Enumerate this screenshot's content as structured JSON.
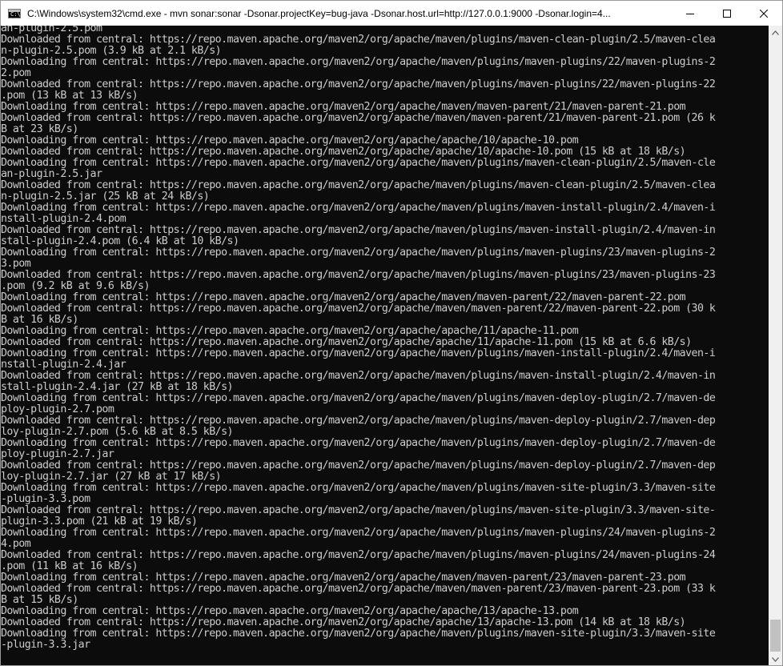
{
  "window": {
    "title": "C:\\Windows\\system32\\cmd.exe - mvn  sonar:sonar -Dsonar.projectKey=bug-java  -Dsonar.host.url=http://127.0.0.1:9000 -Dsonar.login=4...",
    "icon": "console-app-icon",
    "controls": [
      "minimize-icon",
      "maximize-icon",
      "close-icon"
    ]
  },
  "console": {
    "lines": [
      "an-plugin-2.5.pom",
      "Downloaded from central: https://repo.maven.apache.org/maven2/org/apache/maven/plugins/maven-clean-plugin/2.5/maven-clea",
      "n-plugin-2.5.pom (3.9 kB at 2.1 kB/s)",
      "Downloading from central: https://repo.maven.apache.org/maven2/org/apache/maven/plugins/maven-plugins/22/maven-plugins-2",
      "2.pom",
      "Downloaded from central: https://repo.maven.apache.org/maven2/org/apache/maven/plugins/maven-plugins/22/maven-plugins-22",
      ".pom (13 kB at 13 kB/s)",
      "Downloading from central: https://repo.maven.apache.org/maven2/org/apache/maven/maven-parent/21/maven-parent-21.pom",
      "Downloaded from central: https://repo.maven.apache.org/maven2/org/apache/maven/maven-parent/21/maven-parent-21.pom (26 k",
      "B at 23 kB/s)",
      "Downloading from central: https://repo.maven.apache.org/maven2/org/apache/apache/10/apache-10.pom",
      "Downloaded from central: https://repo.maven.apache.org/maven2/org/apache/apache/10/apache-10.pom (15 kB at 18 kB/s)",
      "Downloading from central: https://repo.maven.apache.org/maven2/org/apache/maven/plugins/maven-clean-plugin/2.5/maven-cle",
      "an-plugin-2.5.jar",
      "Downloaded from central: https://repo.maven.apache.org/maven2/org/apache/maven/plugins/maven-clean-plugin/2.5/maven-clea",
      "n-plugin-2.5.jar (25 kB at 24 kB/s)",
      "Downloading from central: https://repo.maven.apache.org/maven2/org/apache/maven/plugins/maven-install-plugin/2.4/maven-i",
      "nstall-plugin-2.4.pom",
      "Downloaded from central: https://repo.maven.apache.org/maven2/org/apache/maven/plugins/maven-install-plugin/2.4/maven-in",
      "stall-plugin-2.4.pom (6.4 kB at 10 kB/s)",
      "Downloading from central: https://repo.maven.apache.org/maven2/org/apache/maven/plugins/maven-plugins/23/maven-plugins-2",
      "3.pom",
      "Downloaded from central: https://repo.maven.apache.org/maven2/org/apache/maven/plugins/maven-plugins/23/maven-plugins-23",
      ".pom (9.2 kB at 9.6 kB/s)",
      "Downloading from central: https://repo.maven.apache.org/maven2/org/apache/maven/maven-parent/22/maven-parent-22.pom",
      "Downloaded from central: https://repo.maven.apache.org/maven2/org/apache/maven/maven-parent/22/maven-parent-22.pom (30 k",
      "B at 16 kB/s)",
      "Downloading from central: https://repo.maven.apache.org/maven2/org/apache/apache/11/apache-11.pom",
      "Downloaded from central: https://repo.maven.apache.org/maven2/org/apache/apache/11/apache-11.pom (15 kB at 6.6 kB/s)",
      "Downloading from central: https://repo.maven.apache.org/maven2/org/apache/maven/plugins/maven-install-plugin/2.4/maven-i",
      "nstall-plugin-2.4.jar",
      "Downloaded from central: https://repo.maven.apache.org/maven2/org/apache/maven/plugins/maven-install-plugin/2.4/maven-in",
      "stall-plugin-2.4.jar (27 kB at 18 kB/s)",
      "Downloading from central: https://repo.maven.apache.org/maven2/org/apache/maven/plugins/maven-deploy-plugin/2.7/maven-de",
      "ploy-plugin-2.7.pom",
      "Downloaded from central: https://repo.maven.apache.org/maven2/org/apache/maven/plugins/maven-deploy-plugin/2.7/maven-dep",
      "loy-plugin-2.7.pom (5.6 kB at 8.5 kB/s)",
      "Downloading from central: https://repo.maven.apache.org/maven2/org/apache/maven/plugins/maven-deploy-plugin/2.7/maven-de",
      "ploy-plugin-2.7.jar",
      "Downloaded from central: https://repo.maven.apache.org/maven2/org/apache/maven/plugins/maven-deploy-plugin/2.7/maven-dep",
      "loy-plugin-2.7.jar (27 kB at 17 kB/s)",
      "Downloading from central: https://repo.maven.apache.org/maven2/org/apache/maven/plugins/maven-site-plugin/3.3/maven-site",
      "-plugin-3.3.pom",
      "Downloaded from central: https://repo.maven.apache.org/maven2/org/apache/maven/plugins/maven-site-plugin/3.3/maven-site-",
      "plugin-3.3.pom (21 kB at 19 kB/s)",
      "Downloading from central: https://repo.maven.apache.org/maven2/org/apache/maven/plugins/maven-plugins/24/maven-plugins-2",
      "4.pom",
      "Downloaded from central: https://repo.maven.apache.org/maven2/org/apache/maven/plugins/maven-plugins/24/maven-plugins-24",
      ".pom (11 kB at 16 kB/s)",
      "Downloading from central: https://repo.maven.apache.org/maven2/org/apache/maven/maven-parent/23/maven-parent-23.pom",
      "Downloaded from central: https://repo.maven.apache.org/maven2/org/apache/maven/maven-parent/23/maven-parent-23.pom (33 k",
      "B at 15 kB/s)",
      "Downloading from central: https://repo.maven.apache.org/maven2/org/apache/apache/13/apache-13.pom",
      "Downloaded from central: https://repo.maven.apache.org/maven2/org/apache/apache/13/apache-13.pom (14 kB at 18 kB/s)",
      "Downloading from central: https://repo.maven.apache.org/maven2/org/apache/maven/plugins/maven-site-plugin/3.3/maven-site",
      "-plugin-3.3.jar"
    ]
  },
  "scrollbar": {
    "position": "bottom"
  },
  "colors": {
    "console_background": "#0c0c0c",
    "console_text": "#cccccc",
    "titlebar_background": "#ffffff",
    "scrollbar_track": "#f0f0f0",
    "scrollbar_thumb": "#c1c1c1"
  }
}
